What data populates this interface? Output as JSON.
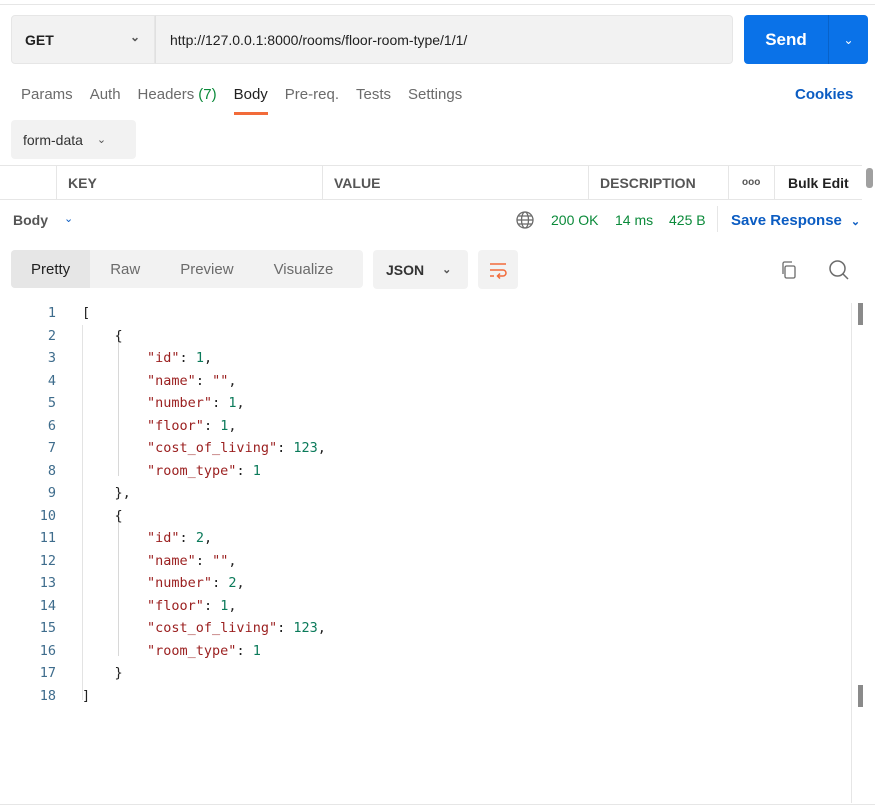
{
  "request": {
    "method": "GET",
    "url": "http://127.0.0.1:8000/rooms/floor-room-type/1/1/",
    "send_label": "Send"
  },
  "tabs": [
    {
      "label": "Params"
    },
    {
      "label": "Auth"
    },
    {
      "label": "Headers",
      "count": "(7)"
    },
    {
      "label": "Body",
      "active": true
    },
    {
      "label": "Pre-req."
    },
    {
      "label": "Tests"
    },
    {
      "label": "Settings"
    }
  ],
  "cookies_label": "Cookies",
  "body_type": "form-data",
  "table_headers": {
    "key": "KEY",
    "value": "VALUE",
    "description": "DESCRIPTION",
    "more": "ooo",
    "bulk_edit": "Bulk Edit"
  },
  "response": {
    "label": "Body",
    "status": "200 OK",
    "time": "14 ms",
    "size": "425 B",
    "save_label": "Save Response"
  },
  "view_tabs": [
    "Pretty",
    "Raw",
    "Preview",
    "Visualize"
  ],
  "format": "JSON",
  "colors": {
    "accent": "#0a72e8",
    "tab_underline": "#f26b3a",
    "status": "#0b8a3a"
  },
  "code_lines": [
    [
      [
        "p",
        "["
      ]
    ],
    [
      [
        "p",
        "    {"
      ]
    ],
    [
      [
        "p",
        "        "
      ],
      [
        "k",
        "\"id\""
      ],
      [
        "p",
        ": "
      ],
      [
        "v",
        "1"
      ],
      [
        "p",
        ","
      ]
    ],
    [
      [
        "p",
        "        "
      ],
      [
        "k",
        "\"name\""
      ],
      [
        "p",
        ": "
      ],
      [
        "s",
        "\"\""
      ],
      [
        "p",
        ","
      ]
    ],
    [
      [
        "p",
        "        "
      ],
      [
        "k",
        "\"number\""
      ],
      [
        "p",
        ": "
      ],
      [
        "v",
        "1"
      ],
      [
        "p",
        ","
      ]
    ],
    [
      [
        "p",
        "        "
      ],
      [
        "k",
        "\"floor\""
      ],
      [
        "p",
        ": "
      ],
      [
        "v",
        "1"
      ],
      [
        "p",
        ","
      ]
    ],
    [
      [
        "p",
        "        "
      ],
      [
        "k",
        "\"cost_of_living\""
      ],
      [
        "p",
        ": "
      ],
      [
        "v",
        "123"
      ],
      [
        "p",
        ","
      ]
    ],
    [
      [
        "p",
        "        "
      ],
      [
        "k",
        "\"room_type\""
      ],
      [
        "p",
        ": "
      ],
      [
        "v",
        "1"
      ]
    ],
    [
      [
        "p",
        "    },"
      ]
    ],
    [
      [
        "p",
        "    {"
      ]
    ],
    [
      [
        "p",
        "        "
      ],
      [
        "k",
        "\"id\""
      ],
      [
        "p",
        ": "
      ],
      [
        "v",
        "2"
      ],
      [
        "p",
        ","
      ]
    ],
    [
      [
        "p",
        "        "
      ],
      [
        "k",
        "\"name\""
      ],
      [
        "p",
        ": "
      ],
      [
        "s",
        "\"\""
      ],
      [
        "p",
        ","
      ]
    ],
    [
      [
        "p",
        "        "
      ],
      [
        "k",
        "\"number\""
      ],
      [
        "p",
        ": "
      ],
      [
        "v",
        "2"
      ],
      [
        "p",
        ","
      ]
    ],
    [
      [
        "p",
        "        "
      ],
      [
        "k",
        "\"floor\""
      ],
      [
        "p",
        ": "
      ],
      [
        "v",
        "1"
      ],
      [
        "p",
        ","
      ]
    ],
    [
      [
        "p",
        "        "
      ],
      [
        "k",
        "\"cost_of_living\""
      ],
      [
        "p",
        ": "
      ],
      [
        "v",
        "123"
      ],
      [
        "p",
        ","
      ]
    ],
    [
      [
        "p",
        "        "
      ],
      [
        "k",
        "\"room_type\""
      ],
      [
        "p",
        ": "
      ],
      [
        "v",
        "1"
      ]
    ],
    [
      [
        "p",
        "    }"
      ]
    ],
    [
      [
        "p",
        "]"
      ]
    ]
  ]
}
